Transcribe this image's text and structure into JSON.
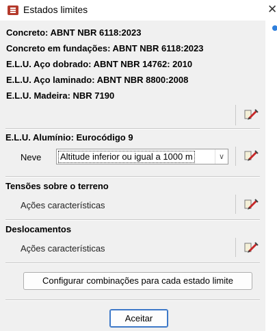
{
  "window": {
    "title": "Estados limites",
    "icon": "estados-limites-app-icon",
    "close_icon": "close-x-icon"
  },
  "norms": [
    "Concreto: ABNT NBR 6118:2023",
    "Concreto em fundações: ABNT NBR 6118:2023",
    "E.L.U. Aço dobrado: ABNT NBR 14762: 2010",
    "E.L.U. Aço laminado: ABNT NBR 8800:2008",
    "E.L.U. Madeira: NBR 7190"
  ],
  "aluminio": {
    "title": "E.L.U. Alumínio: Eurocódigo 9",
    "neve_label": "Neve",
    "neve_value": "Altitude inferior ou igual a 1000 m"
  },
  "tensoes": {
    "title": "Tensões sobre o terreno",
    "subtitle": "Ações características"
  },
  "deslocamentos": {
    "title": "Deslocamentos",
    "subtitle": "Ações características"
  },
  "buttons": {
    "configurar": "Configurar combinações para cada estado limite",
    "aceitar": "Aceitar"
  },
  "icons": {
    "edit": "edit-pencil-icon",
    "dropdown": "chevron-down-icon"
  }
}
